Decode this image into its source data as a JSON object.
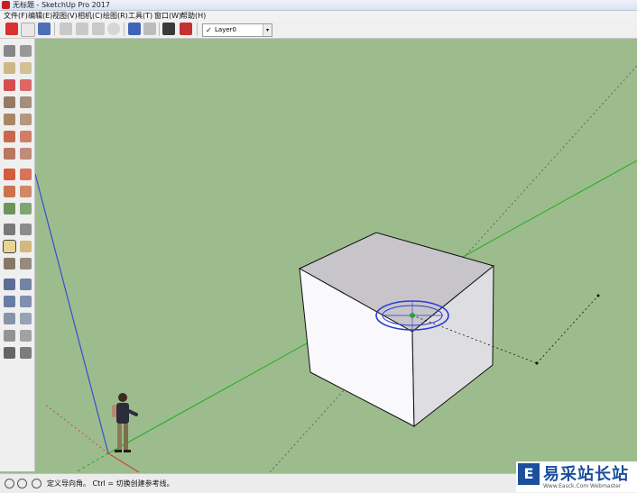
{
  "window": {
    "title": "无标题 - SketchUp Pro 2017"
  },
  "menu": [
    "文件(F)",
    "编辑(E)",
    "视图(V)",
    "相机(C)",
    "绘图(R)",
    "工具(T)",
    "窗口(W)",
    "帮助(H)"
  ],
  "toolbar": {
    "icons": [
      "getting-started-icon",
      "new-file-icon",
      "open-file-icon",
      "save-icon",
      "cut-icon",
      "copy-icon",
      "paste-icon",
      "erase-icon",
      "undo-icon",
      "redo-icon",
      "print-icon",
      "model-info-icon"
    ],
    "layer": {
      "checked": "✓",
      "name": "Layer0",
      "dropdown_arrow": "▾"
    }
  },
  "left_tools": [
    [
      "select-icon",
      "component-icon"
    ],
    [
      "paint-bucket-icon",
      "eraser-icon"
    ],
    [
      "line-icon",
      "freehand-icon"
    ],
    [
      "rectangle-icon",
      "rotated-rectangle-icon"
    ],
    [
      "circle-icon",
      "polygon-icon"
    ],
    [
      "arc-icon",
      "two-point-arc-icon"
    ],
    [
      "three-point-arc-icon",
      "pie-icon"
    ],
    [
      "move-icon",
      "push-pull-icon"
    ],
    [
      "rotate-icon",
      "follow-me-icon"
    ],
    [
      "scale-icon",
      "offset-icon"
    ],
    [
      "tape-measure-icon",
      "dimension-icon"
    ],
    [
      "protractor-icon",
      "text-icon"
    ],
    [
      "axes-icon",
      "3d-text-icon"
    ],
    [
      "orbit-icon",
      "pan-icon"
    ],
    [
      "zoom-icon",
      "zoom-window-icon"
    ],
    [
      "zoom-extents-icon",
      "previous-view-icon"
    ],
    [
      "position-camera-icon",
      "look-around-icon"
    ],
    [
      "walk-icon",
      "section-plane-icon"
    ]
  ],
  "active_tool": "protractor-icon",
  "status": {
    "message": "定义导向角。 Ctrl = 切换创建参考线。"
  },
  "watermark": {
    "title": "易采站长站",
    "url": "Www.Easck.Com  Webmaster"
  },
  "colors": {
    "sky": "#9cbc8d",
    "blue_axis": "#3a4bd0",
    "green_axis": "#1fb01f",
    "red_axis": "#d03030",
    "protractor": "#2a3ad0"
  }
}
